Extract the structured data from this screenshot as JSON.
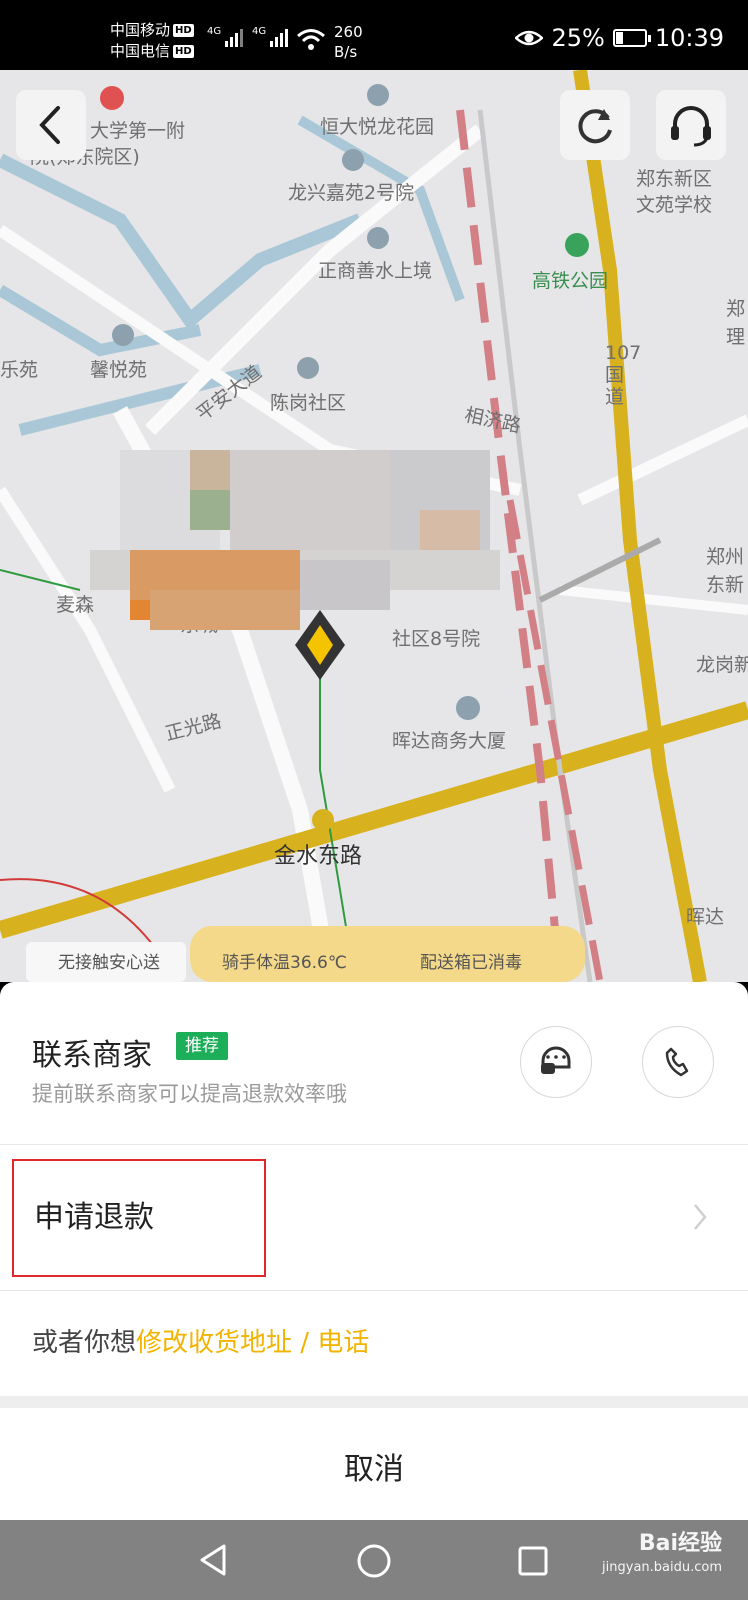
{
  "status_bar": {
    "carrier_1": "中国移动",
    "carrier_2": "中国电信",
    "hd": "HD",
    "network": "4G",
    "speed_value": "260",
    "speed_unit": "B/s",
    "battery": "25%",
    "battery_level": 0.25,
    "time": "10:39"
  },
  "map": {
    "labels": {
      "hospital": "大学第一附",
      "hospital_2": "院(郑东院区)",
      "hengda": "恒大悦龙花园",
      "longxing": "龙兴嘉苑2号院",
      "zhengshang": "正商善水上境",
      "pingan": "平安大道",
      "xinyue": "馨悦苑",
      "yuan_left": "乐苑",
      "chengang": "陈岗社区",
      "gaotie": "高铁公园",
      "zhengdong_school": "郑东新区",
      "zhengdong_school_2": "文苑学校",
      "edge_zheng": "郑",
      "edge_li": "理",
      "xiangji": "相济路",
      "road107": "107国道",
      "zhengzhou_east": "郑州",
      "zhengzhou_east_2": "东新",
      "longgang": "龙岗新",
      "maisen": "麦森",
      "dongcheng": "东城",
      "community8": "社区8号院",
      "zhengguang": "正光路",
      "huida": "晖达商务大厦",
      "jinshui": "金水东路",
      "huida_edge": "晖达",
      "bottom_left": "无接触安心送",
      "bottom_mid": "骑手体温36.6℃",
      "bottom_right": "配送箱已消毒"
    }
  },
  "sheet": {
    "contact_title": "联系商家",
    "contact_badge": "推荐",
    "contact_sub": "提前联系商家可以提高退款效率哦",
    "refund_label": "申请退款",
    "alt_prefix": "或者你想",
    "alt_link_address": "修改收货地址",
    "alt_sep": " / ",
    "alt_link_phone": "电话",
    "cancel_label": "取消"
  },
  "watermark": {
    "brand": "Bai经验",
    "url": "jingyan.baidu.com"
  }
}
